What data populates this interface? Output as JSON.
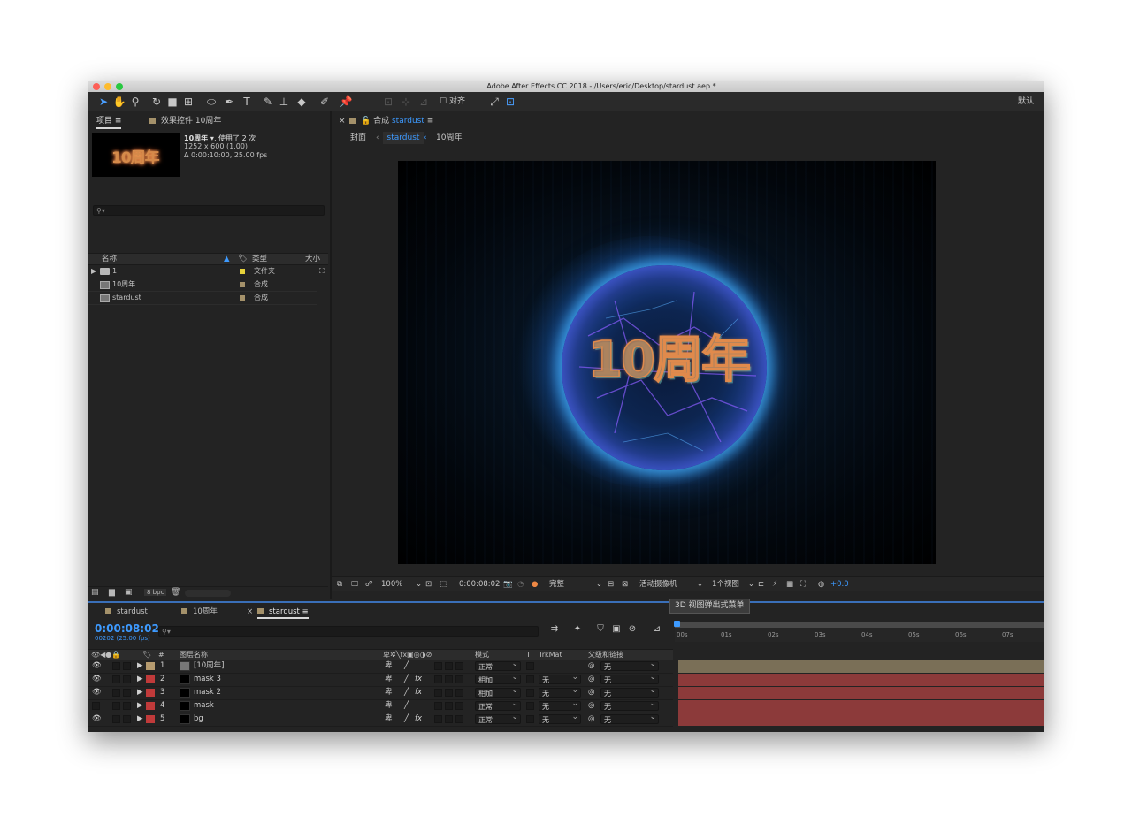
{
  "window": {
    "title": "Adobe After Effects CC 2018 - /Users/eric/Desktop/stardust.aep *"
  },
  "toolbar": {
    "snap_label": "对齐",
    "workspace_label": "默认",
    "tools": [
      "selection-tool",
      "hand-tool",
      "zoom-tool",
      "rotate-tool",
      "camera-tool",
      "pan-behind-tool",
      "ellipse-tool",
      "pen-tool",
      "type-tool",
      "brush-tool",
      "clone-stamp-tool",
      "eraser-tool",
      "roto-brush-tool",
      "puppet-pin-tool"
    ]
  },
  "project_panel": {
    "tab_project": "项目",
    "tab_effects": "效果控件 10周年",
    "thumb_text": "10周年",
    "selected_name": "10周年 ▾",
    "usage": ", 使用了 2 次",
    "dimensions": "1252 x 600 (1.00)",
    "duration": "Δ 0:00:10:00, 25.00 fps",
    "columns": {
      "name": "名称",
      "type": "类型",
      "size": "大小"
    },
    "items": [
      {
        "name": "1",
        "type": "文件夹",
        "kind": "folder",
        "color": "#e6d23a"
      },
      {
        "name": "10周年",
        "type": "合成",
        "kind": "comp",
        "color": "#a4916a"
      },
      {
        "name": "stardust",
        "type": "合成",
        "kind": "comp",
        "color": "#a4916a"
      }
    ],
    "bpc": "8 bpc"
  },
  "comp_panel": {
    "tab_label": "合成",
    "tab_comp": "stardust",
    "breadcrumbs": [
      "封面",
      "stardust",
      "10周年"
    ],
    "canvas_text": "10周年",
    "zoom": "100%",
    "timecode": "0:00:08:02",
    "resolution": "完整",
    "camera": "活动摄像机",
    "views": "1个视图",
    "exposure": "+0.0",
    "tooltip": "3D 视图弹出式菜单"
  },
  "timeline": {
    "tabs": [
      "stardust",
      "10周年",
      "stardust"
    ],
    "timecode": "0:00:08:02",
    "frames": "00202 (25.00 fps)",
    "columns": {
      "num": "#",
      "layer_name": "图层名称",
      "mode": "模式",
      "t": "T",
      "trkmat": "TrkMat",
      "parent": "父级和链接"
    },
    "layers": [
      {
        "num": "1",
        "name": "[10周年]",
        "mode": "正常",
        "trkmat": "",
        "parent": "无",
        "color": "#b59a6e",
        "visible": true,
        "fx": false,
        "bar": "#7a6f57"
      },
      {
        "num": "2",
        "name": "mask 3",
        "mode": "相加",
        "trkmat": "无",
        "parent": "无",
        "color": "#c03a3a",
        "visible": true,
        "fx": true,
        "bar": "#8c3a3a"
      },
      {
        "num": "3",
        "name": "mask 2",
        "mode": "相加",
        "trkmat": "无",
        "parent": "无",
        "color": "#c03a3a",
        "visible": true,
        "fx": true,
        "bar": "#8c3a3a"
      },
      {
        "num": "4",
        "name": "mask",
        "mode": "正常",
        "trkmat": "无",
        "parent": "无",
        "color": "#c03a3a",
        "visible": false,
        "fx": false,
        "bar": "#8c3a3a"
      },
      {
        "num": "5",
        "name": "bg",
        "mode": "正常",
        "trkmat": "无",
        "parent": "无",
        "color": "#c03a3a",
        "visible": true,
        "fx": true,
        "bar": "#8c3a3a"
      }
    ],
    "ruler": [
      "00s",
      "01s",
      "02s",
      "03s",
      "04s",
      "05s",
      "06s",
      "07s"
    ],
    "accent": "#3d9aff"
  }
}
